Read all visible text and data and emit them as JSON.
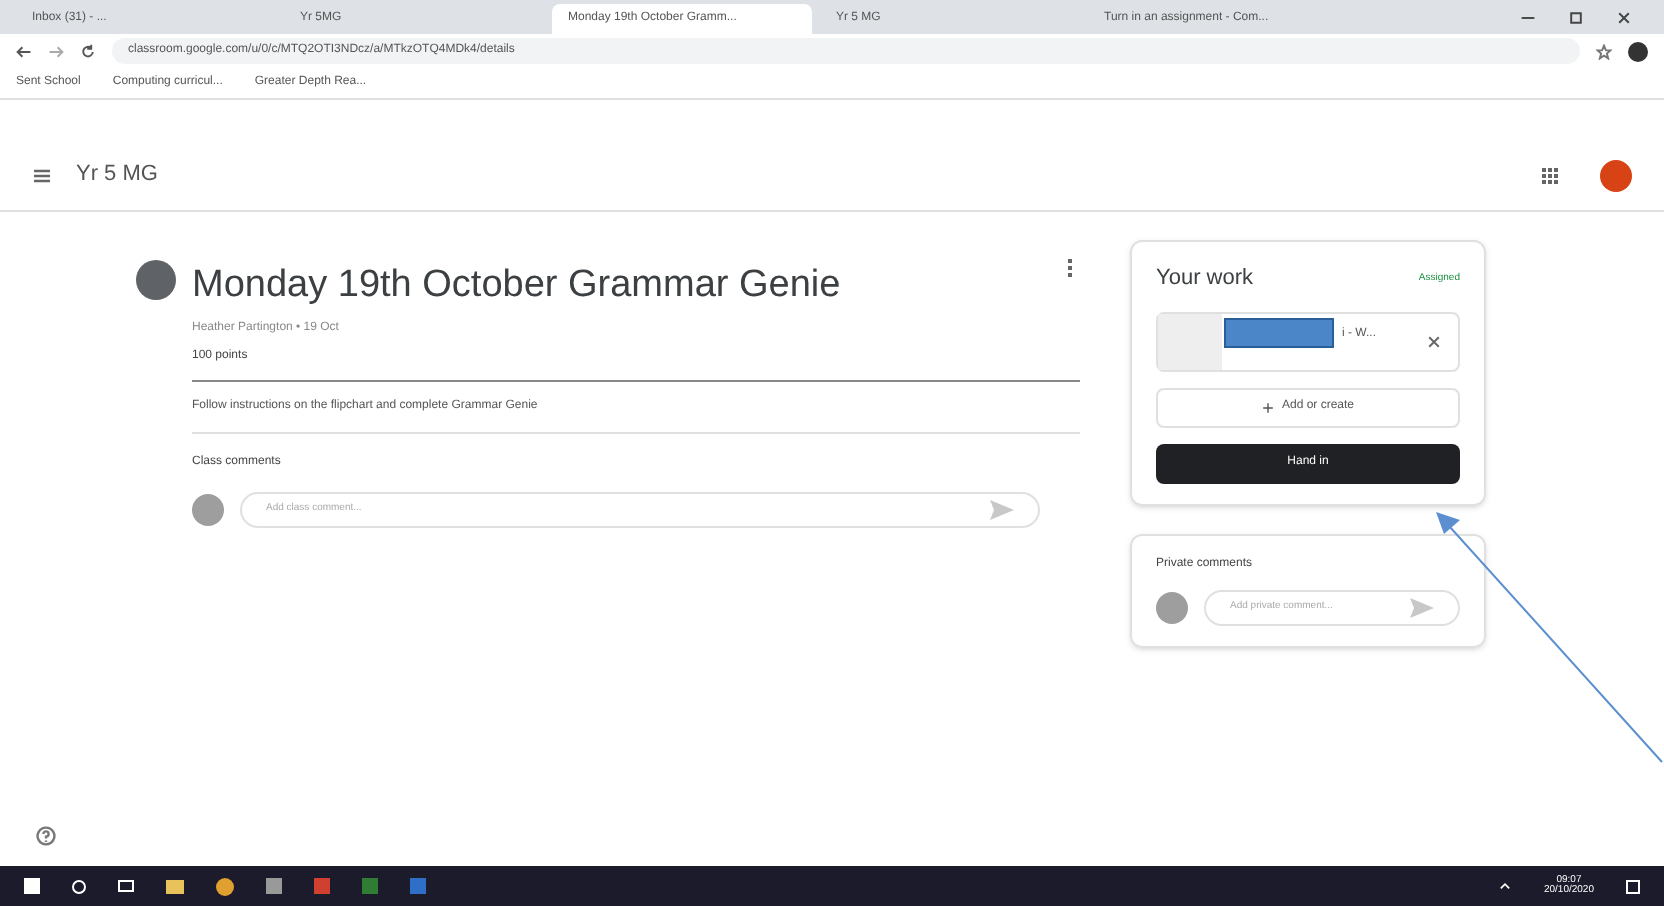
{
  "browser": {
    "tabs": [
      {
        "label": "Inbox (31) - ...",
        "selected": false
      },
      {
        "label": "Yr 5MG",
        "selected": false
      },
      {
        "label": "Monday 19th October Gramm...",
        "selected": true
      },
      {
        "label": "Yr 5 MG",
        "selected": false
      },
      {
        "label": "Turn in an assignment - Com...",
        "selected": false
      }
    ],
    "url": "classroom.google.com/u/0/c/MTQ2OTI3NDcz/a/MTkzOTQ4MDk4/details",
    "bookmarks": [
      "Sent School",
      "Computing curricul...",
      "Greater Depth Rea..."
    ]
  },
  "app_bar": {
    "class_name": "Yr 5 MG"
  },
  "assignment": {
    "title": "Monday 19th October Grammar Genie",
    "meta": "Heather Partington • 19 Oct",
    "points": "100 points",
    "instructions": "Follow instructions on the flipchart and complete Grammar Genie",
    "comments_label": "Class comments",
    "comment_placeholder": "Add class comment..."
  },
  "your_work": {
    "title": "Your work",
    "status": "Assigned",
    "attachment": "i - W...",
    "add_label": "Add or create",
    "hand_in": "Hand in"
  },
  "private_comments": {
    "title": "Private comments",
    "placeholder": "Add private comment..."
  },
  "taskbar": {
    "time": "09:07",
    "date": "20/10/2020"
  }
}
